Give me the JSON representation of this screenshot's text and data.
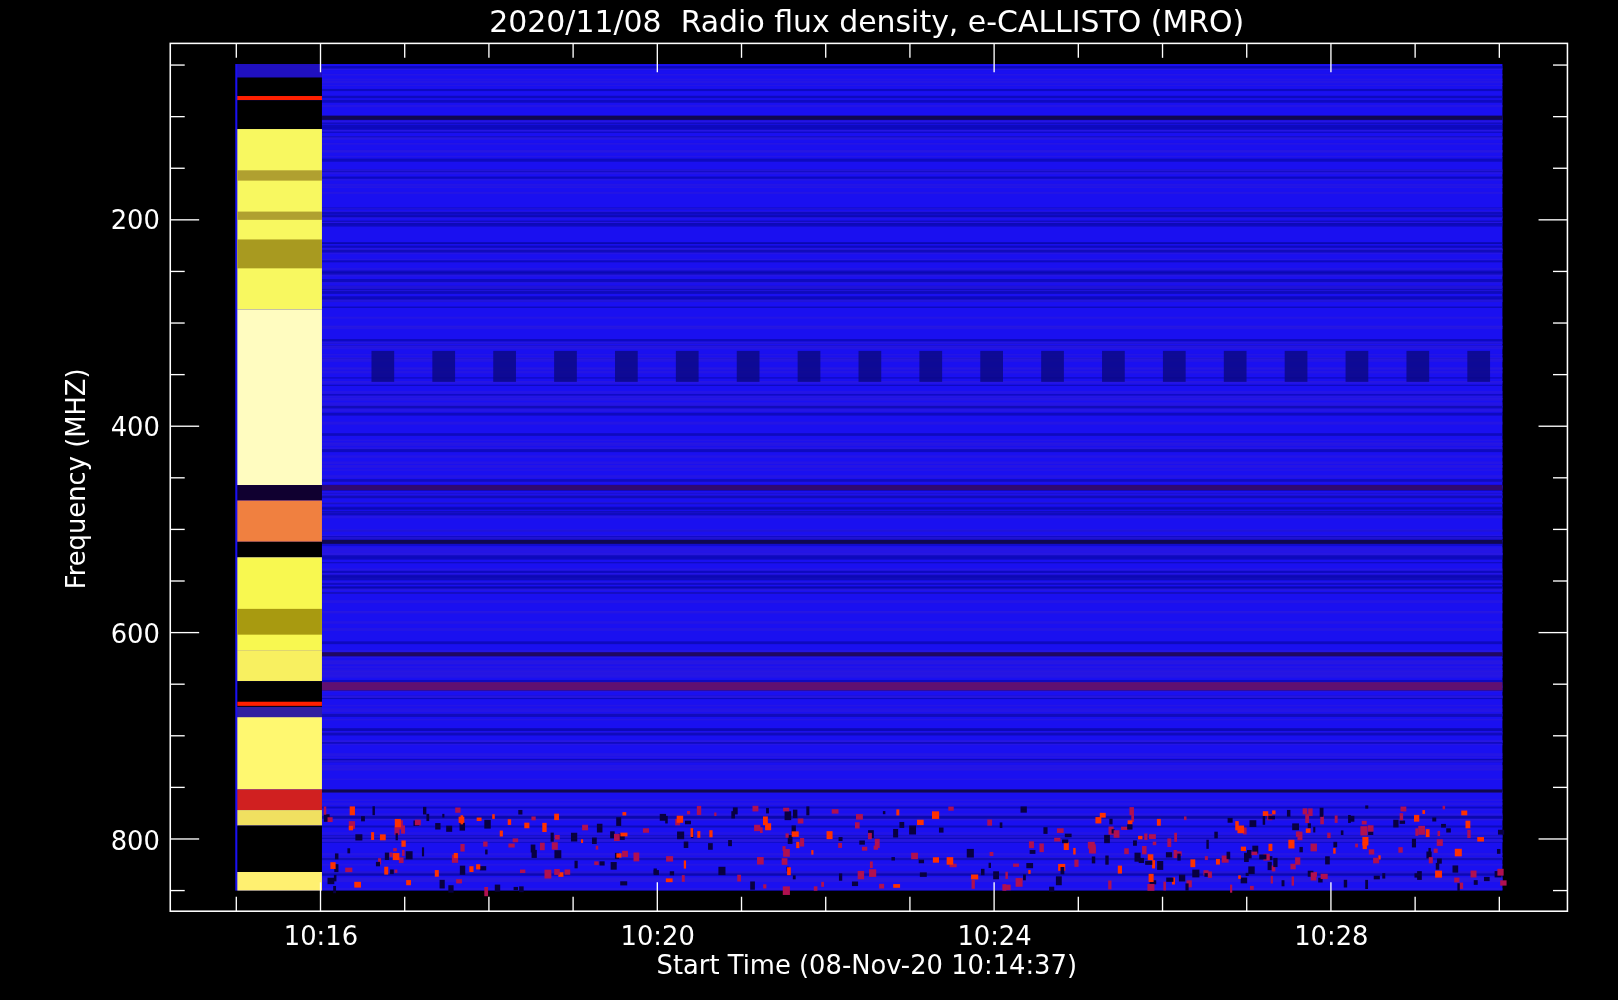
{
  "title": "2020/11/08  Radio flux density, e-CALLISTO (MRO)",
  "y_axis": {
    "label": "Frequency (MHZ)",
    "tick_labels": [
      "200",
      "400",
      "600",
      "800"
    ]
  },
  "x_axis": {
    "label": "Start Time (08-Nov-20 10:14:37)",
    "tick_labels": [
      "10:16",
      "10:20",
      "10:24",
      "10:28"
    ]
  }
}
